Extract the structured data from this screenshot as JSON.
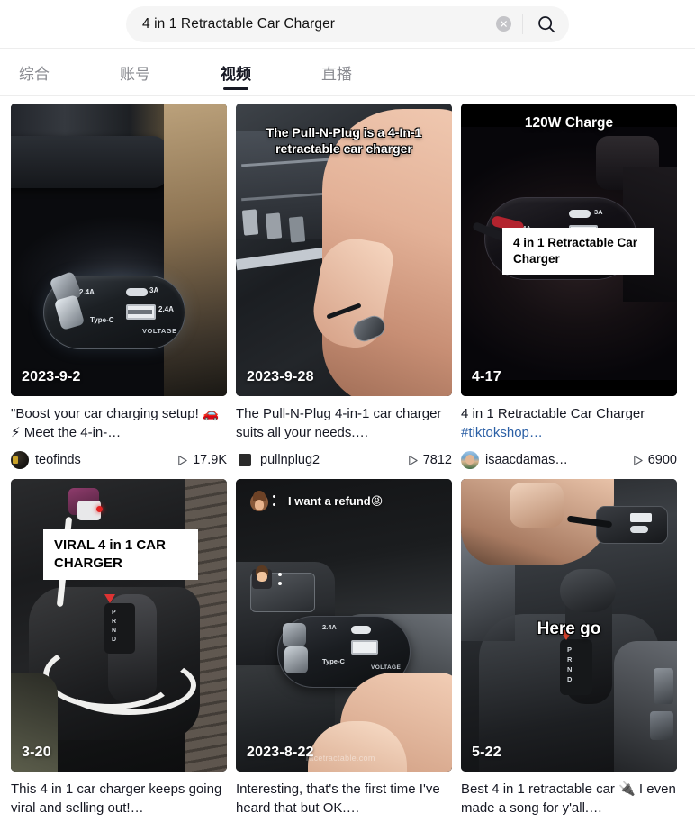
{
  "search": {
    "value": "4 in 1 Retractable Car Charger",
    "placeholder": "搜索",
    "clear_icon": "clear-circle-icon",
    "search_icon": "search-icon"
  },
  "tabs": [
    {
      "label": "综合",
      "active": false
    },
    {
      "label": "账号",
      "active": false
    },
    {
      "label": "视频",
      "active": true
    },
    {
      "label": "直播",
      "active": false
    }
  ],
  "colors": {
    "accent_cyan": "#25f4ee",
    "accent_pink": "#fe2c55",
    "text_primary": "#161823",
    "text_muted": "#8a8b91",
    "link_blue": "#2b5fa5"
  },
  "videos": [
    {
      "date": "2023-9-2",
      "overlay_text": "",
      "description": "\"Boost your car charging setup! 🚗⚡ Meet the 4-in-…",
      "author": "teofinds",
      "plays": "17.9K"
    },
    {
      "date": "2023-9-28",
      "overlay_text": "The Pull-N-Plug is a 4-In-1 retractable car charger",
      "description": "The Pull-N-Plug 4-in-1 car charger suits all your needs.…",
      "author": "pullnplug2",
      "plays": "7812"
    },
    {
      "date": "4-17",
      "overlay_top": "120W Charge",
      "overlay_box": "4 in 1 Retractable Car Charger",
      "description": "4 in 1 Retractable Car Charger ",
      "description_tag": "#tiktokshop…",
      "author": "isaacdamas…",
      "plays": "6900"
    },
    {
      "date": "3-20",
      "overlay_box": "VIRAL 4 in 1 CAR CHARGER",
      "description": "This 4 in 1 car charger keeps going viral and selling out!…",
      "author": "",
      "plays": ""
    },
    {
      "date": "2023-8-22",
      "overlay_text": "I want a refund😡",
      "watermark": "racetractable.com",
      "description": "Interesting, that's the first time I've heard that but OK.…",
      "author": "",
      "plays": ""
    },
    {
      "date": "5-22",
      "overlay_text": "Here go",
      "description": "Best 4 in 1 retractable car 🔌 I even made a song for y'all.…",
      "author": "",
      "plays": ""
    }
  ]
}
